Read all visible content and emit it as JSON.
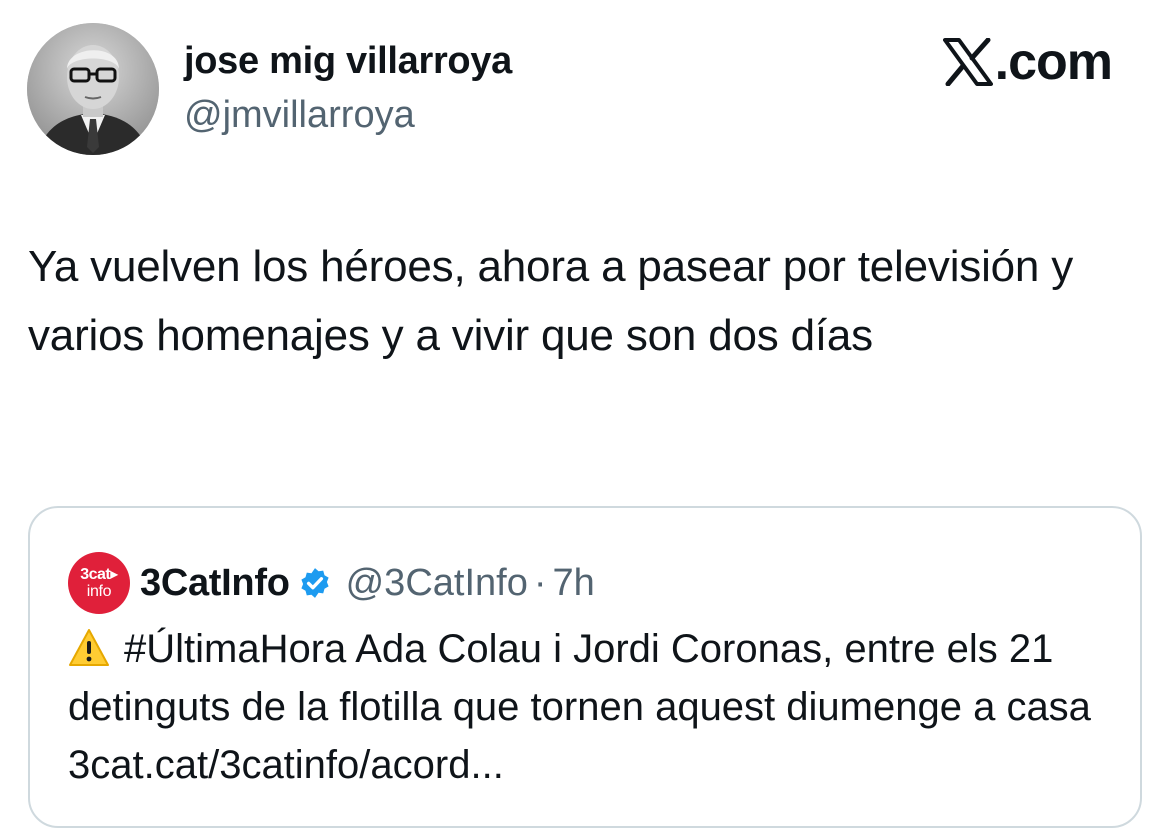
{
  "author": {
    "name": "jose mig villarroya",
    "handle": "@jmvillarroya",
    "avatar_icon": "profile-photo-icon"
  },
  "site": {
    "logo_text": ".com",
    "logo_icon": "x-logo-icon"
  },
  "tweet": {
    "text": "Ya vuelven los héroes, ahora a pasear por televisión y varios homenajes y a vivir que son dos días"
  },
  "quoted": {
    "avatar_line1": "3cat▸",
    "avatar_line2": "info",
    "avatar_color": "#e0203a",
    "name": "3CatInfo",
    "verified_icon": "verified-badge-icon",
    "verified_color": "#1d9bf0",
    "handle": "@3CatInfo",
    "separator": "·",
    "time": "7h",
    "warning_icon": "warning-icon",
    "text": "#ÚltimaHora Ada Colau i Jordi Coronas, entre els 21 detinguts de la flotilla que tornen aquest diumenge a casa 3cat.cat/3catinfo/acord..."
  }
}
